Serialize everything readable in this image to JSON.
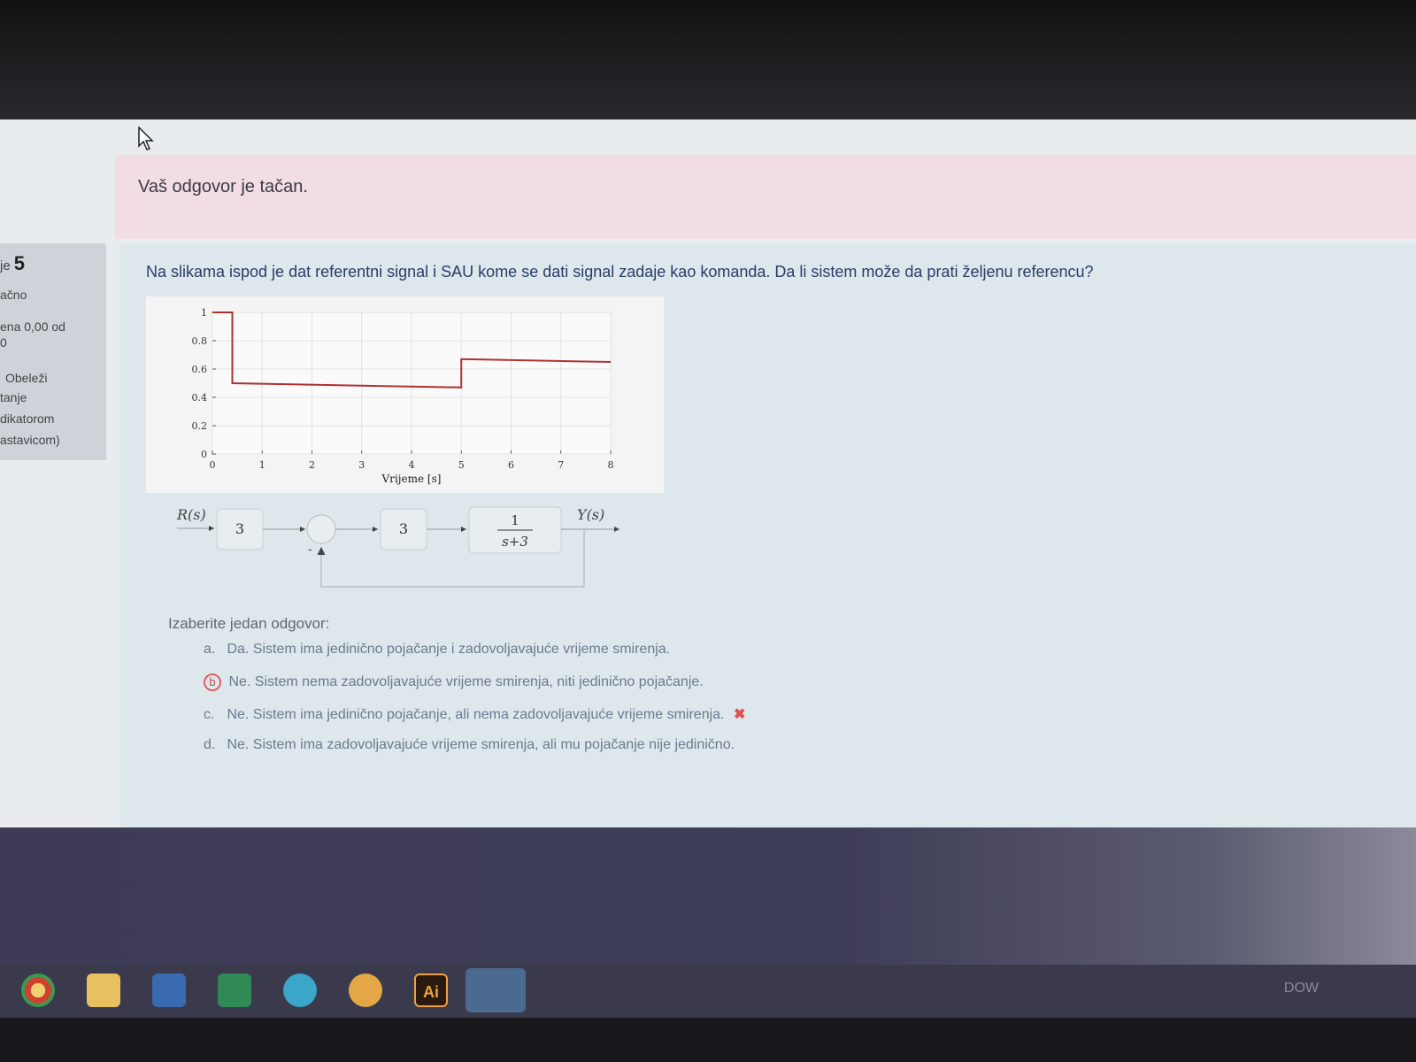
{
  "feedback": {
    "text": "Vaš odgovor je tačan."
  },
  "info": {
    "question_prefix": "je",
    "question_number": "5",
    "state": "ačno",
    "grade_line1": "ena 0,00 od",
    "grade_line2": "0",
    "flag_line1": "Obeleži",
    "flag_line2": "tanje",
    "flag_line3": "dikatorom",
    "flag_line4": "astavicom)"
  },
  "question": {
    "text": "Na slikama ispod je dat referentni signal i SAU kome se dati signal zadaje kao komanda. Da li sistem može da prati željenu referencu?"
  },
  "chart_data": {
    "type": "line",
    "xlabel": "Vrijeme [s]",
    "ylabel": "",
    "xlim": [
      0,
      8
    ],
    "ylim": [
      0,
      1
    ],
    "x_ticks": [
      "0",
      "1",
      "2",
      "3",
      "4",
      "5",
      "6",
      "7",
      "8"
    ],
    "y_ticks": [
      "0",
      "0.2",
      "0.4",
      "0.6",
      "0.8",
      "1"
    ],
    "grid": true,
    "series": [
      {
        "color": "#b03030",
        "x": [
          0,
          0.4,
          0.4,
          5,
          5,
          8
        ],
        "y": [
          1,
          1,
          0.5,
          0.47,
          0.67,
          0.65
        ]
      }
    ]
  },
  "diagram": {
    "input_label": "R(s)",
    "gain1": "3",
    "gain2": "3",
    "tf_num": "1",
    "tf_den": "s+3",
    "output_label": "Y(s)",
    "minus_sign": "-"
  },
  "answers": {
    "prompt": "Izaberite jedan odgovor:",
    "options": [
      {
        "letter": "a.",
        "text": "Da. Sistem ima jedinično pojačanje i zadovoljavajuće vrijeme smirenja."
      },
      {
        "letter": "b",
        "text": "Ne. Sistem nema zadovoljavajuće vrijeme smirenja, niti jedinično pojačanje."
      },
      {
        "letter": "c.",
        "text": "Ne. Sistem ima jedinično pojačanje, ali nema zadovoljavajuće vrijeme smirenja."
      },
      {
        "letter": "d.",
        "text": "Ne. Sistem ima zadovoljavajuće vrijeme smirenja, ali mu pojačanje nije jedinično."
      }
    ],
    "wrong_mark": "✖"
  },
  "taskbar": {
    "label": "DOW",
    "ai_label": "Ai"
  }
}
